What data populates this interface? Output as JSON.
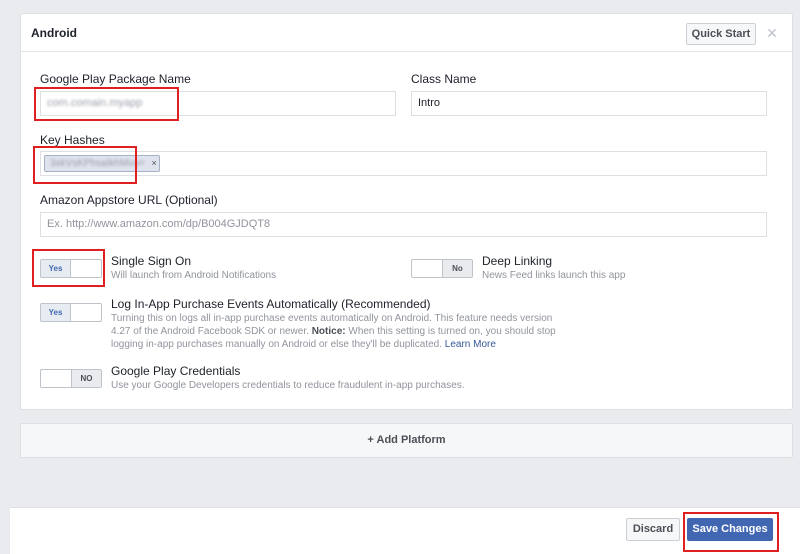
{
  "panel": {
    "title": "Android",
    "quick_start_label": "Quick Start",
    "close_glyph": "✕"
  },
  "fields": {
    "package_name": {
      "label": "Google Play Package Name",
      "value": "com.comain.myapp"
    },
    "class_name": {
      "label": "Class Name",
      "value": "Intro"
    },
    "key_hashes": {
      "label": "Key Hashes",
      "token": "3xkVsKPhsaIkhMva=",
      "remove_glyph": "×"
    },
    "amazon_url": {
      "label": "Amazon Appstore URL (Optional)",
      "placeholder": "Ex. http://www.amazon.com/dp/B004GJDQT8"
    }
  },
  "options": {
    "single_sign_on": {
      "title": "Single Sign On",
      "desc": "Will launch from Android Notifications",
      "state": "Yes"
    },
    "deep_linking": {
      "title": "Deep Linking",
      "desc": "News Feed links launch this app",
      "state": "No"
    },
    "log_purchase": {
      "title": "Log In-App Purchase Events Automatically (Recommended)",
      "desc_line1": "Turning this on logs all in-app purchase events automatically on Android. This feature needs version",
      "desc_line2_pre": "4.27 of the Android Facebook SDK or newer.",
      "desc_notice": "Notice:",
      "desc_line2_post": "When this setting is turned on, you should stop",
      "desc_line3": "logging in-app purchases manually on Android or else they'll be duplicated.",
      "learn_more": "Learn More",
      "state": "Yes"
    },
    "play_credentials": {
      "title": "Google Play Credentials",
      "desc": "Use your Google Developers credentials to reduce fraudulent in-app purchases.",
      "state": "NO"
    }
  },
  "add_platform": {
    "icon": "+",
    "label": "Add Platform"
  },
  "footer": {
    "discard_label": "Discard",
    "save_label": "Save Changes"
  },
  "colors": {
    "accent": "#4267b2",
    "highlight_box": "#e02020",
    "link": "#365899"
  }
}
